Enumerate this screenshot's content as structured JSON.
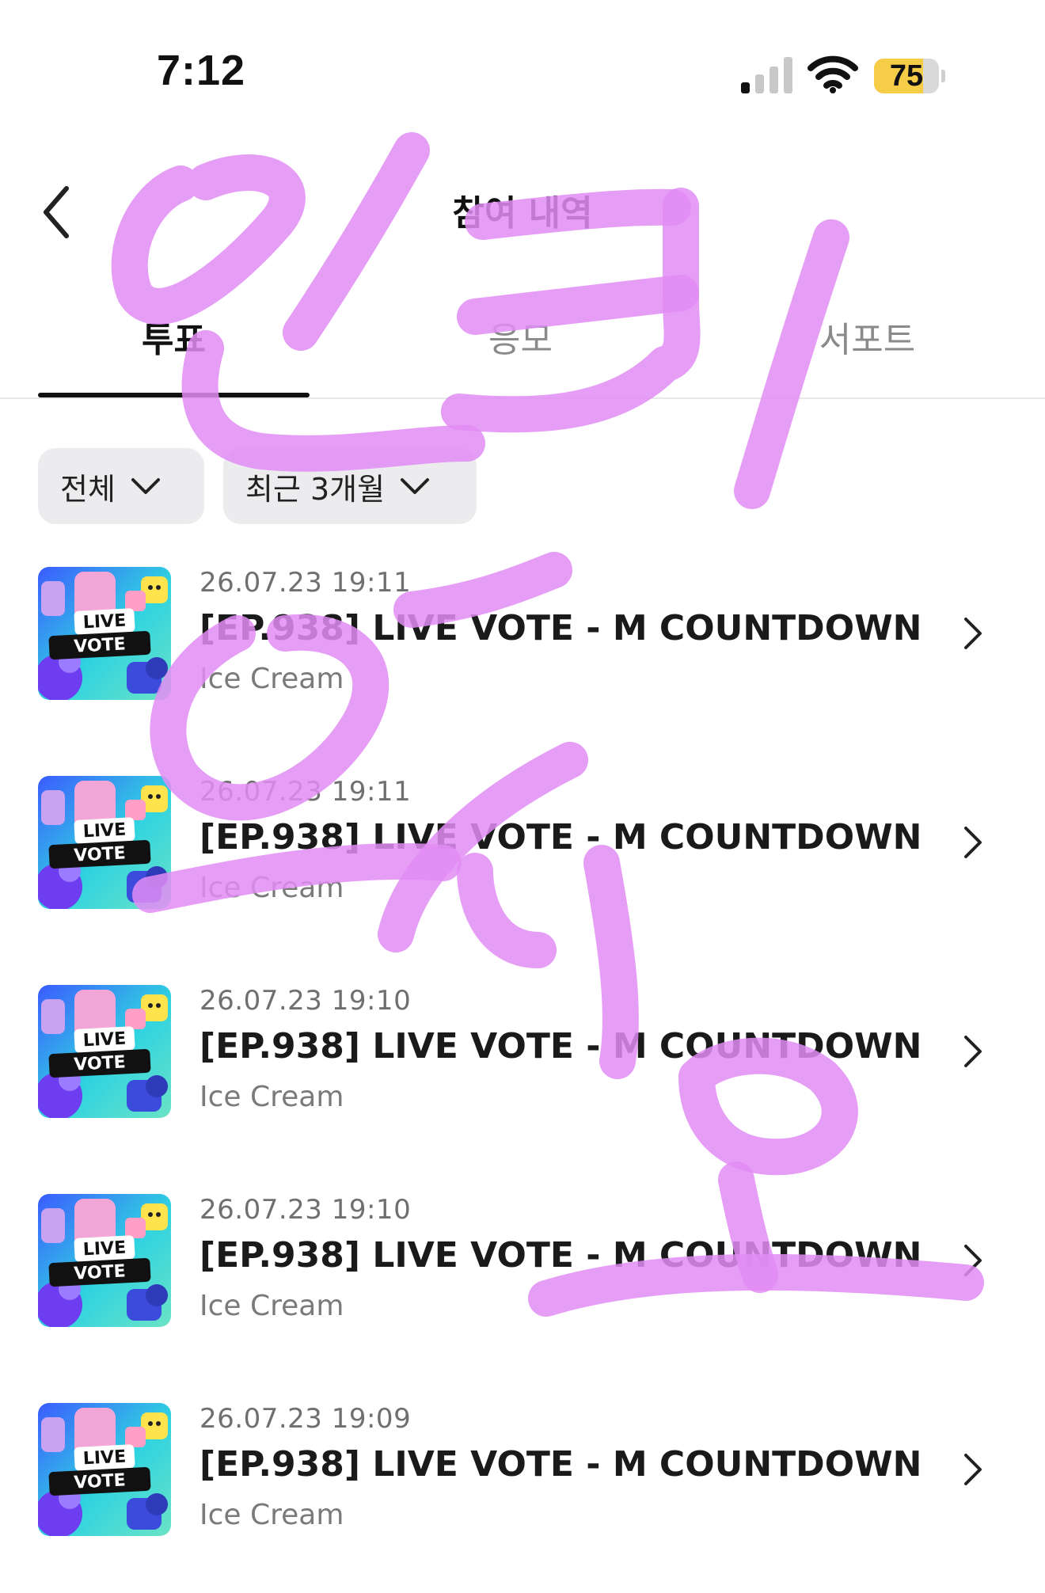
{
  "status_bar": {
    "time": "7:12",
    "battery": "75",
    "battery_level": 0.75,
    "signal_icon": "cellular-signal-icon",
    "wifi_icon": "wifi-icon"
  },
  "header": {
    "back_icon": "chevron-left-icon",
    "title": "참여 내역"
  },
  "tabs": [
    {
      "label": "투표",
      "active": true
    },
    {
      "label": "응모",
      "active": false
    },
    {
      "label": "서포트",
      "active": false
    }
  ],
  "filters": [
    {
      "label": "전체",
      "icon": "chevron-down-icon"
    },
    {
      "label": "최근 3개월",
      "icon": "chevron-down-icon"
    }
  ],
  "votes": [
    {
      "date": "26.07.23 19:11",
      "title": "[EP.938] LIVE VOTE - M COUNTDOWN",
      "subtitle": "Ice Cream",
      "thumb_text": [
        "LIVE",
        "VOTE"
      ]
    },
    {
      "date": "26.07.23 19:11",
      "title": "[EP.938] LIVE VOTE - M COUNTDOWN",
      "subtitle": "Ice Cream",
      "thumb_text": [
        "LIVE",
        "VOTE"
      ]
    },
    {
      "date": "26.07.23 19:10",
      "title": "[EP.938] LIVE VOTE - M COUNTDOWN",
      "subtitle": "Ice Cream",
      "thumb_text": [
        "LIVE",
        "VOTE"
      ]
    },
    {
      "date": "26.07.23 19:10",
      "title": "[EP.938] LIVE VOTE - M COUNTDOWN",
      "subtitle": "Ice Cream",
      "thumb_text": [
        "LIVE",
        "VOTE"
      ]
    },
    {
      "date": "26.07.23 19:09",
      "title": "[EP.938] LIVE VOTE - M COUNTDOWN",
      "subtitle": "Ice Cream",
      "thumb_text": [
        "LIVE",
        "VOTE"
      ]
    }
  ],
  "colors": {
    "accent_text": "#111111",
    "chip_bg": "#ececee",
    "battery_fill": "#f5cd47",
    "scribble": "#e28cf5"
  }
}
